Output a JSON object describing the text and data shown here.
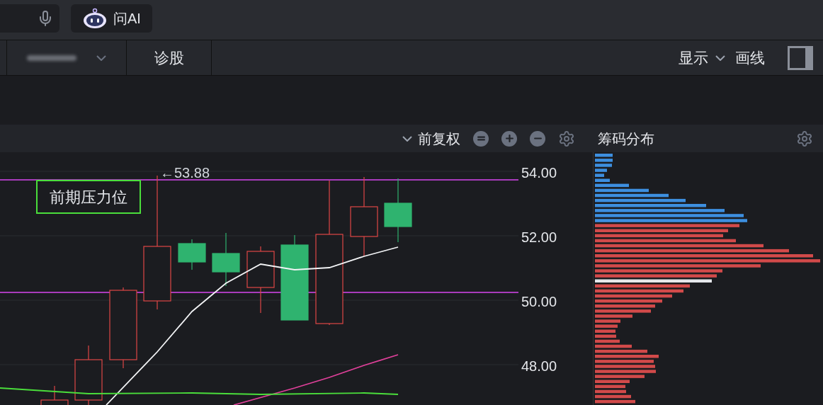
{
  "top_bar": {
    "ask_ai": "问AI"
  },
  "toolbar": {
    "diagnose": "诊股",
    "display": "显示",
    "draw_line": "画线"
  },
  "chart_header": {
    "adjust": "前复权",
    "chip_title": "筹码分布"
  },
  "chart": {
    "y_labels": [
      "54.00",
      "52.00",
      "50.00",
      "48.00"
    ],
    "high_marker": "←53.88",
    "callout": "前期压力位"
  }
}
